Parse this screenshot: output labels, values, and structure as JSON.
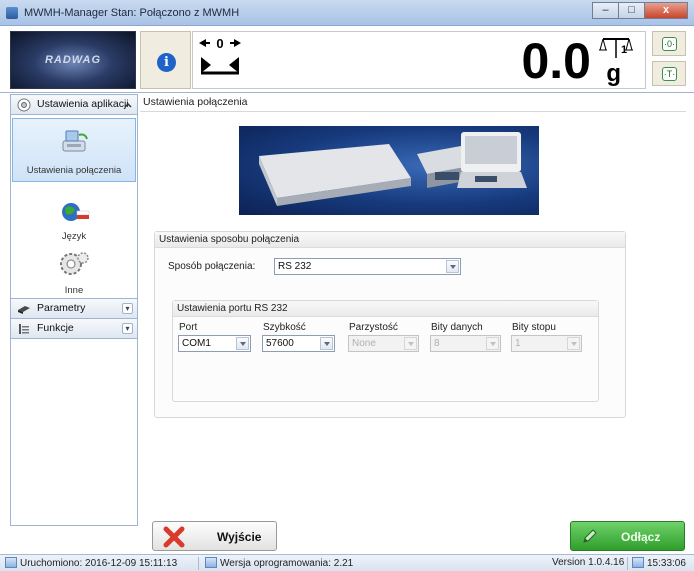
{
  "window": {
    "title": "MWMH-Manager  Stan: Połączono z MWMH",
    "minimize_label": "–",
    "maximize_label": "□",
    "close_label": "x"
  },
  "header": {
    "logo_text": "RADWAG",
    "weight_value": "0.0",
    "unit": "g",
    "zero_label": "0",
    "range_label": "1",
    "side_buttons": [
      {
        "icon": "weighing-mode-in-icon",
        "glyph": "·0·"
      },
      {
        "icon": "weighing-mode-out-icon",
        "glyph": "·T·"
      }
    ]
  },
  "sidebar": {
    "sections": [
      {
        "label": "Ustawienia aplikacji",
        "expanded": true,
        "items": [
          {
            "label": "Ustawienia połączenia",
            "selected": true,
            "icon": "connection-settings-icon"
          },
          {
            "label": "Język",
            "selected": false,
            "icon": "language-flags-icon"
          },
          {
            "label": "Inne",
            "selected": false,
            "icon": "gears-icon"
          }
        ]
      },
      {
        "label": "Parametry",
        "expanded": false
      },
      {
        "label": "Funkcje",
        "expanded": false
      }
    ]
  },
  "content": {
    "breadcrumb": "Ustawienia połączenia",
    "connection_group": {
      "title": "Ustawienia sposobu połączenia",
      "method_label": "Sposób połączenia:",
      "method_value": "RS 232"
    },
    "port_group": {
      "title": "Ustawienia portu RS 232",
      "fields": [
        {
          "label": "Port",
          "value": "COM1",
          "enabled": true
        },
        {
          "label": "Szybkość",
          "value": "57600",
          "enabled": true
        },
        {
          "label": "Parzystość",
          "value": "None",
          "enabled": false
        },
        {
          "label": "Bity danych",
          "value": "8",
          "enabled": false
        },
        {
          "label": "Bity stopu",
          "value": "1",
          "enabled": false
        }
      ]
    }
  },
  "buttons": {
    "exit_label": "Wyjście",
    "disconnect_label": "Odłącz"
  },
  "statusbar": {
    "started": "Uruchomiono: 2016-12-09 15:11:13",
    "software_version": "Wersja oprogramowania: 2.21",
    "version": "Version 1.0.4.16",
    "time": "15:33:06"
  },
  "colors": {
    "accent_green": "#3aa935",
    "info_blue": "#1f63c8",
    "exit_red": "#d83a2c"
  }
}
